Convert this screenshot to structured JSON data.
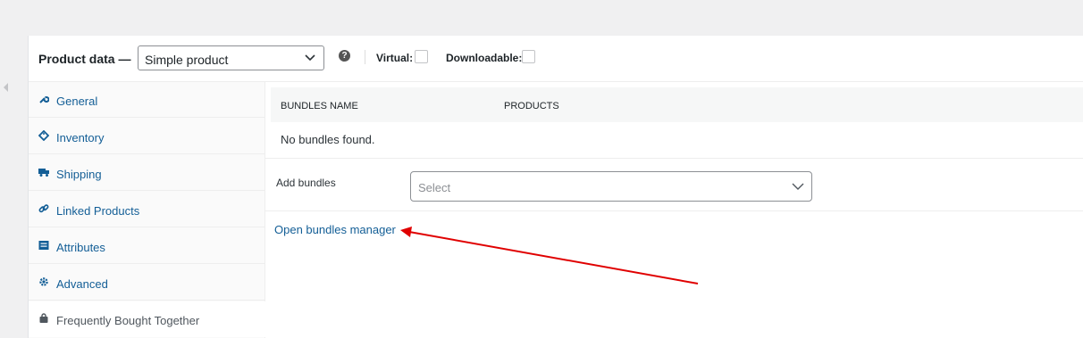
{
  "header": {
    "title": "Product data —",
    "product_type": "Simple product",
    "help_symbol": "?",
    "virtual_label": "Virtual:",
    "downloadable_label": "Downloadable:"
  },
  "tabs": [
    {
      "label": "General",
      "icon": "wrench-icon"
    },
    {
      "label": "Inventory",
      "icon": "tag-icon"
    },
    {
      "label": "Shipping",
      "icon": "truck-icon"
    },
    {
      "label": "Linked Products",
      "icon": "link-icon"
    },
    {
      "label": "Attributes",
      "icon": "list-icon"
    },
    {
      "label": "Advanced",
      "icon": "gear-icon"
    },
    {
      "label": "Frequently Bought Together",
      "icon": "bag-icon"
    }
  ],
  "bundles": {
    "columns": [
      "Bundles name",
      "Products"
    ],
    "empty_message": "No bundles found.",
    "add_label": "Add bundles",
    "select_placeholder": "Select",
    "manager_link": "Open bundles manager"
  },
  "colors": {
    "link": "#135e96",
    "annotation_arrow": "#e00000"
  }
}
